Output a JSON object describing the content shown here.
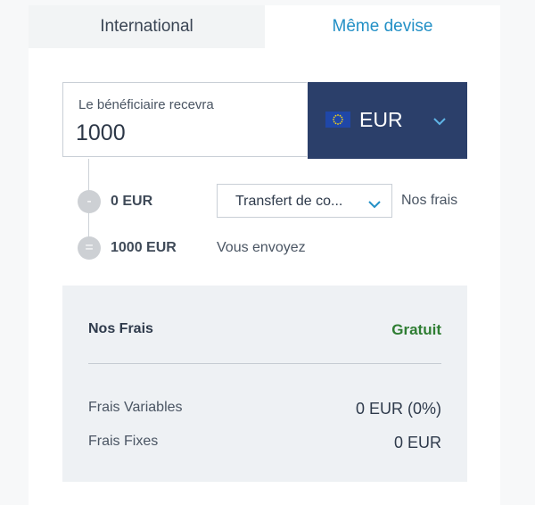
{
  "tabs": [
    {
      "label": "International"
    },
    {
      "label": "Même devise"
    }
  ],
  "recipient": {
    "label": "Le bénéficiaire recevra",
    "amount": "1000"
  },
  "currency": {
    "code": "EUR",
    "flag_icon": "eu-flag-icon"
  },
  "breakdown": {
    "minus_symbol": "-",
    "equals_symbol": "=",
    "fee_amount": "0 EUR",
    "total_amount": "1000 EUR",
    "transfer_type": "Transfert de co...",
    "fee_label": "Nos frais",
    "send_label": "Vous envoyez"
  },
  "fees": {
    "title": "Nos Frais",
    "status": "Gratuit",
    "variable_label": "Frais Variables",
    "variable_value": "0 EUR (0%)",
    "fixed_label": "Frais Fixes",
    "fixed_value": "0 EUR"
  },
  "colors": {
    "accent": "#2390c6",
    "currency_bg": "#2b3f6a",
    "free_green": "#2e7d32",
    "panel_bg": "#eef1f4"
  }
}
